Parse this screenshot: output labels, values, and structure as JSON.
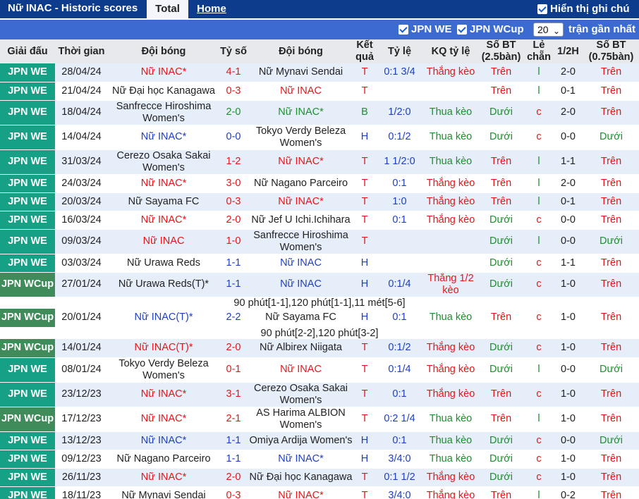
{
  "header": {
    "title": "Nữ INAC - Historic scores",
    "tabs": [
      "Total",
      "Home"
    ],
    "show_handicap_label": "Hiển thị ghi chú"
  },
  "filters": {
    "leagues": [
      "JPN WE",
      "JPN WCup"
    ],
    "match_count": "20",
    "match_count_suffix": "trận gần nhất"
  },
  "table": {
    "columns": [
      "Giải đấu",
      "Thời gian",
      "Đội bóng",
      "Tỷ số",
      "Đội bóng",
      "Kết quả",
      "Tỷ lệ",
      "KQ tỷ lệ",
      "Số BT (2.5bàn)",
      "Lẻ chẵn",
      "1/2H",
      "Số BT (0.75bàn)"
    ],
    "rows": [
      {
        "league": "JPN WE",
        "date": "28/04/24",
        "home": "Nữ INAC*",
        "score": "4-1",
        "away": "Nữ Mynavi Sendai",
        "result": "T",
        "odds": "0:1 3/4",
        "odds_result": "Thắng kèo",
        "ou25": "Trên",
        "oe": "l",
        "half": "2-0",
        "ou075": "Trên"
      },
      {
        "league": "JPN WE",
        "date": "21/04/24",
        "home": "Nữ Đại học Kanagawa",
        "score": "0-3",
        "away": "Nữ INAC",
        "result": "T",
        "odds": "",
        "odds_result": "",
        "ou25": "Trên",
        "oe": "l",
        "half": "0-1",
        "ou075": "Trên"
      },
      {
        "league": "JPN WE",
        "date": "18/04/24",
        "home": "Sanfrecce Hiroshima Women's",
        "score": "2-0",
        "away": "Nữ INAC*",
        "result": "B",
        "odds": "1/2:0",
        "odds_result": "Thua kèo",
        "ou25": "Dưới",
        "oe": "c",
        "half": "2-0",
        "ou075": "Trên"
      },
      {
        "league": "JPN WE",
        "date": "14/04/24",
        "home": "Nữ INAC*",
        "score": "0-0",
        "away": "Tokyo Verdy Beleza Women's",
        "result": "H",
        "odds": "0:1/2",
        "odds_result": "Thua kèo",
        "ou25": "Dưới",
        "oe": "c",
        "half": "0-0",
        "ou075": "Dưới"
      },
      {
        "league": "JPN WE",
        "date": "31/03/24",
        "home": "Cerezo Osaka Sakai Women's",
        "score": "1-2",
        "away": "Nữ INAC*",
        "result": "T",
        "odds": "1 1/2:0",
        "odds_result": "Thua kèo",
        "ou25": "Trên",
        "oe": "l",
        "half": "1-1",
        "ou075": "Trên"
      },
      {
        "league": "JPN WE",
        "date": "24/03/24",
        "home": "Nữ INAC*",
        "score": "3-0",
        "away": "Nữ Nagano Parceiro",
        "result": "T",
        "odds": "0:1",
        "odds_result": "Thắng kèo",
        "ou25": "Trên",
        "oe": "l",
        "half": "2-0",
        "ou075": "Trên"
      },
      {
        "league": "JPN WE",
        "date": "20/03/24",
        "home": "Nữ Sayama FC",
        "score": "0-3",
        "away": "Nữ INAC*",
        "result": "T",
        "odds": "1:0",
        "odds_result": "Thắng kèo",
        "ou25": "Trên",
        "oe": "l",
        "half": "0-1",
        "ou075": "Trên"
      },
      {
        "league": "JPN WE",
        "date": "16/03/24",
        "home": "Nữ INAC*",
        "score": "2-0",
        "away": "Nữ Jef U Ichi.Ichihara",
        "result": "T",
        "odds": "0:1",
        "odds_result": "Thắng kèo",
        "ou25": "Dưới",
        "oe": "c",
        "half": "0-0",
        "ou075": "Trên"
      },
      {
        "league": "JPN WE",
        "date": "09/03/24",
        "home": "Nữ INAC",
        "score": "1-0",
        "away": "Sanfrecce Hiroshima Women's",
        "result": "T",
        "odds": "",
        "odds_result": "",
        "ou25": "Dưới",
        "oe": "l",
        "half": "0-0",
        "ou075": "Dưới"
      },
      {
        "league": "JPN WE",
        "date": "03/03/24",
        "home": "Nữ Urawa Reds",
        "score": "1-1",
        "away": "Nữ INAC",
        "result": "H",
        "odds": "",
        "odds_result": "",
        "ou25": "Dưới",
        "oe": "c",
        "half": "1-1",
        "ou075": "Trên"
      },
      {
        "league": "JPN WCup",
        "date": "27/01/24",
        "home": "Nữ Urawa Reds(T)*",
        "score": "1-1",
        "away": "Nữ INAC",
        "result": "H",
        "odds": "0:1/4",
        "odds_result": "Thắng 1/2 kèo",
        "ou25": "Dưới",
        "oe": "c",
        "half": "1-0",
        "ou075": "Trên",
        "note": "90 phút[1-1],120 phút[1-1],11 mét[5-6]"
      },
      {
        "league": "JPN WCup",
        "date": "20/01/24",
        "home": "Nữ INAC(T)*",
        "score": "2-2",
        "away": "Nữ Sayama FC",
        "result": "H",
        "odds": "0:1",
        "odds_result": "Thua kèo",
        "ou25": "Trên",
        "oe": "c",
        "half": "1-0",
        "ou075": "Trên",
        "note": "90 phút[2-2],120 phút[3-2]"
      },
      {
        "league": "JPN WCup",
        "date": "14/01/24",
        "home": "Nữ INAC(T)*",
        "score": "2-0",
        "away": "Nữ Albirex Niigata",
        "result": "T",
        "odds": "0:1/2",
        "odds_result": "Thắng kèo",
        "ou25": "Dưới",
        "oe": "c",
        "half": "1-0",
        "ou075": "Trên"
      },
      {
        "league": "JPN WE",
        "date": "08/01/24",
        "home": "Tokyo Verdy Beleza Women's",
        "score": "0-1",
        "away": "Nữ INAC",
        "result": "T",
        "odds": "0:1/4",
        "odds_result": "Thắng kèo",
        "ou25": "Dưới",
        "oe": "l",
        "half": "0-0",
        "ou075": "Dưới"
      },
      {
        "league": "JPN WE",
        "date": "23/12/23",
        "home": "Nữ INAC*",
        "score": "3-1",
        "away": "Cerezo Osaka Sakai Women's",
        "result": "T",
        "odds": "0:1",
        "odds_result": "Thắng kèo",
        "ou25": "Trên",
        "oe": "c",
        "half": "1-0",
        "ou075": "Trên"
      },
      {
        "league": "JPN WCup",
        "date": "17/12/23",
        "home": "Nữ INAC*",
        "score": "2-1",
        "away": "AS Harima ALBION Women's",
        "result": "T",
        "odds": "0:2 1/4",
        "odds_result": "Thua kèo",
        "ou25": "Trên",
        "oe": "l",
        "half": "1-0",
        "ou075": "Trên"
      },
      {
        "league": "JPN WE",
        "date": "13/12/23",
        "home": "Nữ INAC*",
        "score": "1-1",
        "away": "Omiya Ardija Women's",
        "result": "H",
        "odds": "0:1",
        "odds_result": "Thua kèo",
        "ou25": "Dưới",
        "oe": "c",
        "half": "0-0",
        "ou075": "Dưới"
      },
      {
        "league": "JPN WE",
        "date": "09/12/23",
        "home": "Nữ Nagano Parceiro",
        "score": "1-1",
        "away": "Nữ INAC*",
        "result": "H",
        "odds": "3/4:0",
        "odds_result": "Thua kèo",
        "ou25": "Dưới",
        "oe": "c",
        "half": "1-0",
        "ou075": "Trên"
      },
      {
        "league": "JPN WE",
        "date": "26/11/23",
        "home": "Nữ INAC*",
        "score": "2-0",
        "away": "Nữ Đại học Kanagawa",
        "result": "T",
        "odds": "0:1 1/2",
        "odds_result": "Thắng kèo",
        "ou25": "Dưới",
        "oe": "c",
        "half": "1-0",
        "ou075": "Trên"
      },
      {
        "league": "JPN WE",
        "date": "18/11/23",
        "home": "Nữ Mynavi Sendai",
        "score": "0-3",
        "away": "Nữ INAC*",
        "result": "T",
        "odds": "3/4:0",
        "odds_result": "Thắng kèo",
        "ou25": "Trên",
        "oe": "l",
        "half": "0-2",
        "ou075": "Trên"
      }
    ]
  },
  "colors": {
    "topbar": "#0e3c8c",
    "filterbar": "#3b6bd1",
    "league_we": "#16a085",
    "league_cup": "#3f8b5a",
    "win": "#e3171b",
    "draw": "#1f3fbf",
    "loss": "#1e8e2e"
  }
}
